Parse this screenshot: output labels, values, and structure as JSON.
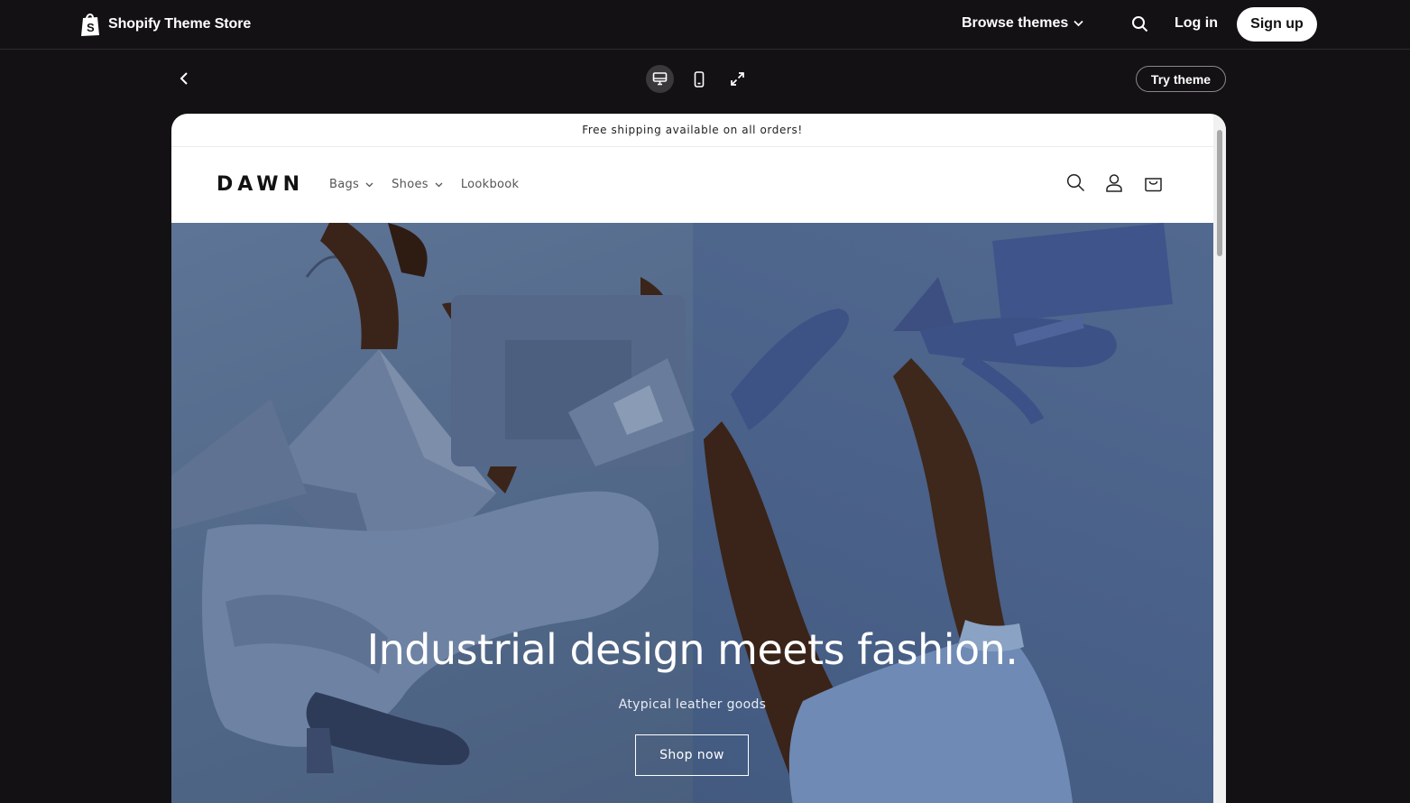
{
  "topbar": {
    "brand": "Shopify Theme Store",
    "browse_label": "Browse themes",
    "login_label": "Log in",
    "signup_label": "Sign up"
  },
  "preview_toolbar": {
    "devices": [
      "desktop-icon",
      "mobile-icon",
      "fullscreen-icon"
    ],
    "active_device": "desktop",
    "try_label": "Try theme"
  },
  "store": {
    "announcement": "Free shipping available on all orders!",
    "logo": "DAWN",
    "nav": [
      {
        "label": "Bags",
        "dropdown": true
      },
      {
        "label": "Shoes",
        "dropdown": true
      },
      {
        "label": "Lookbook",
        "dropdown": false
      }
    ],
    "header_icons": [
      "search-icon",
      "account-icon",
      "cart-icon"
    ],
    "hero": {
      "heading": "Industrial design meets fashion.",
      "subheading": "Atypical leather goods",
      "button_label": "Shop now"
    }
  },
  "colors": {
    "page_bg": "#131113",
    "hero_blue": "#4a5f7d",
    "white": "#ffffff"
  }
}
